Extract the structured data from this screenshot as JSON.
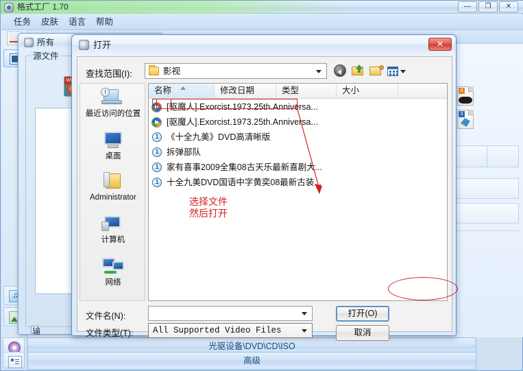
{
  "app": {
    "title": "格式工厂 1.70",
    "icon": "app-icon",
    "window_buttons": {
      "minimize": "—",
      "maximize": "❐",
      "close": "✕"
    },
    "menu": [
      "任务",
      "皮肤",
      "语言",
      "帮助"
    ],
    "bottom_buttons": [
      "光驱设备\\DVD\\CD\\ISO",
      "高级"
    ]
  },
  "bg_dialog": {
    "title": "所有",
    "close_label": "✕",
    "group_legend": "源文件",
    "checkbox_label": "输",
    "media_icon": "wmv-file-icon"
  },
  "open_dialog": {
    "title": "打开",
    "close_label": "✕",
    "lookin_label": "查找范围(I):",
    "lookin_value": "影视",
    "toolbar": {
      "back": "back-arrow-icon",
      "up": "up-one-level-icon",
      "new_folder": "new-folder-icon",
      "views": "views-icon"
    },
    "places": [
      {
        "label": "最近访问的位置",
        "icon": "recent-places-icon"
      },
      {
        "label": "桌面",
        "icon": "desktop-icon"
      },
      {
        "label": "Administrator",
        "icon": "user-folder-icon"
      },
      {
        "label": "计算机",
        "icon": "computer-icon"
      },
      {
        "label": "网络",
        "icon": "network-icon"
      }
    ],
    "columns": [
      {
        "label": "名称",
        "sorted": "asc"
      },
      {
        "label": "修改日期",
        "sorted": ""
      },
      {
        "label": "类型",
        "sorted": ""
      },
      {
        "label": "大小",
        "sorted": ""
      }
    ],
    "files": [
      {
        "name": "[驱魔人].Exorcist.1973.25th.Anniversa...",
        "icon": "media-player-file-icon",
        "selected": true
      },
      {
        "name": "[驱魔人].Exorcist.1973.25th.Anniversa...",
        "icon": "media-player-file-icon",
        "selected": false
      },
      {
        "name": "《十全九美》DVD高清晰版",
        "icon": "one-badge-icon",
        "badge": "1",
        "selected": false
      },
      {
        "name": "拆弹部队",
        "icon": "one-badge-icon",
        "badge": "1",
        "selected": false
      },
      {
        "name": "家有喜事2009全集08古天乐最新喜剧大...",
        "icon": "one-badge-icon",
        "badge": "1",
        "selected": false
      },
      {
        "name": "十全九美DVD国语中字黄奕08最新古装...",
        "icon": "one-badge-icon",
        "badge": "1",
        "selected": false
      }
    ],
    "filename_label": "文件名(N):",
    "filename_value": "",
    "filetype_label": "文件类型(T):",
    "filetype_value": "All Supported Video Files",
    "open_button": "打开(O)",
    "cancel_button": "取消"
  },
  "annotations": {
    "text_line1": "选择文件",
    "text_line2": "然后打开",
    "color": "#d81f1f"
  }
}
